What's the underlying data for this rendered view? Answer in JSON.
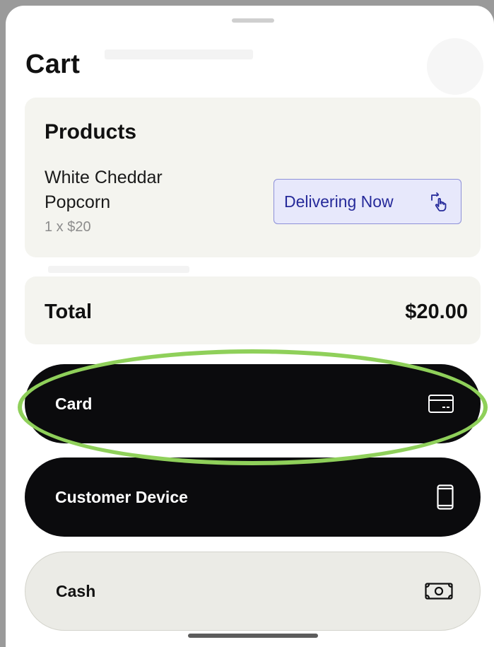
{
  "screen": {
    "title": "Cart"
  },
  "products": {
    "heading": "Products",
    "item_name": "White Cheddar Popcorn",
    "item_quantity": "1 x $20",
    "delivery_button_label": "Delivering Now",
    "delivery_button_icon": "swipe-tap-icon"
  },
  "total": {
    "label": "Total",
    "value": "$20.00"
  },
  "payment_options": [
    {
      "label": "Card",
      "icon": "credit-card-icon",
      "style": "dark",
      "highlighted": true
    },
    {
      "label": "Customer Device",
      "icon": "phone-icon",
      "style": "dark",
      "highlighted": false
    },
    {
      "label": "Cash",
      "icon": "banknote-icon",
      "style": "light",
      "highlighted": false
    }
  ],
  "colors": {
    "card_background": "#f4f4ef",
    "dark_button": "#0b0b0d",
    "light_button": "#ebebe6",
    "delivery_button_fill": "#e7e8fb",
    "delivery_button_text": "#262a9a",
    "highlight_ring": "#8fd05a"
  }
}
